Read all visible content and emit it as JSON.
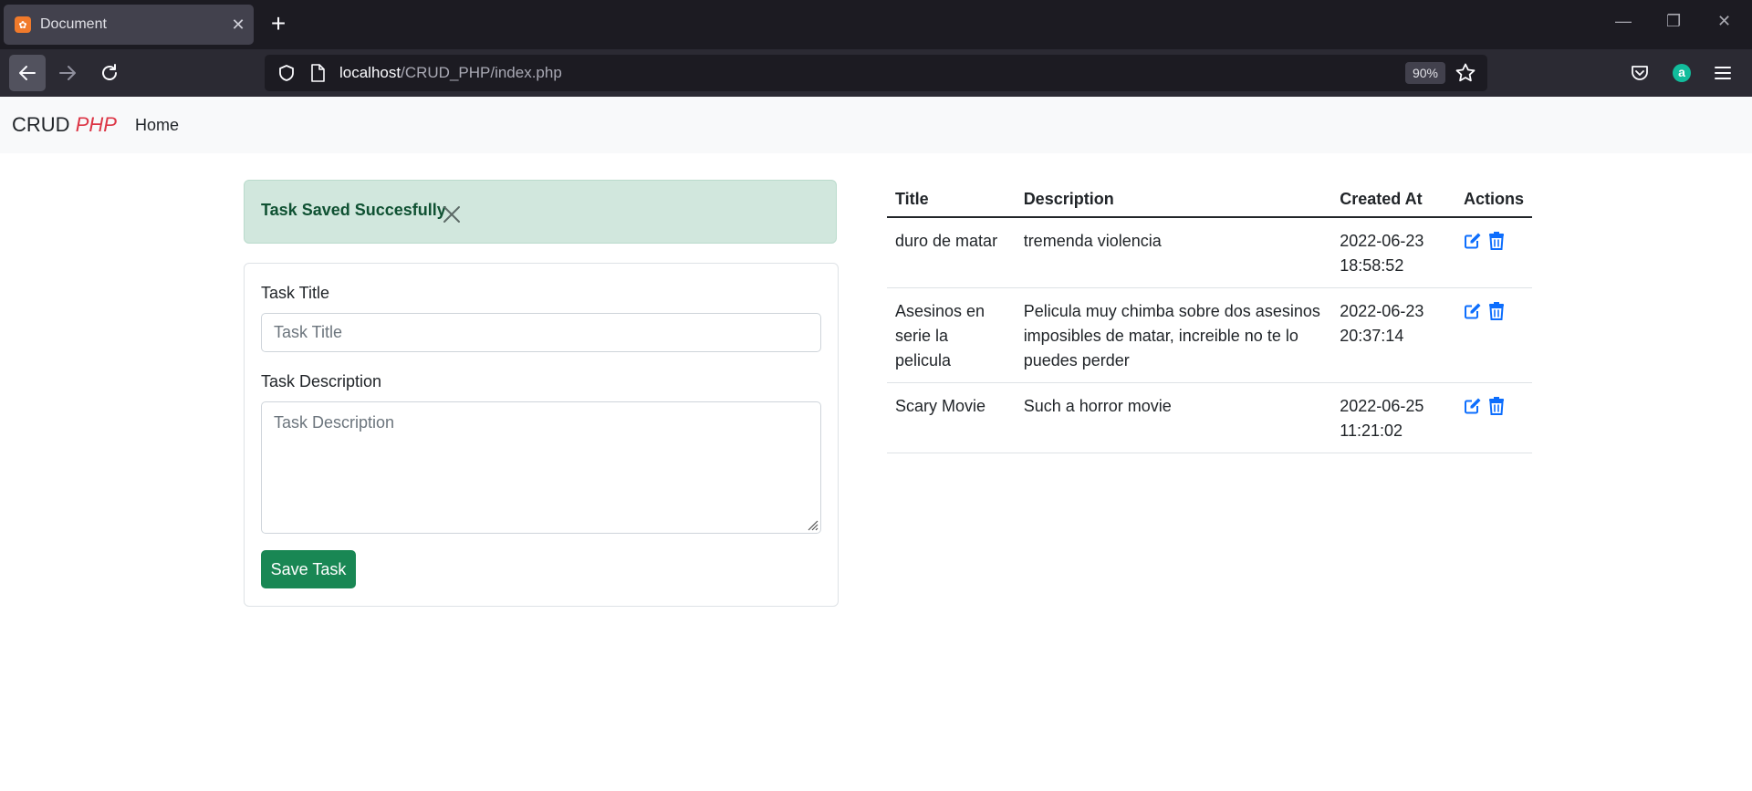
{
  "browser": {
    "tab": {
      "title": "Document",
      "favicon": "xampp-icon"
    },
    "url": {
      "host": "localhost",
      "path": "/CRUD_PHP/index.php"
    },
    "zoom": "90%"
  },
  "navbar": {
    "brand": "CRUD",
    "brand_accent": "PHP",
    "home": "Home"
  },
  "alert": {
    "message": "Task Saved Succesfully"
  },
  "form": {
    "title_label": "Task Title",
    "title_placeholder": "Task Title",
    "title_value": "",
    "description_label": "Task Description",
    "description_placeholder": "Task Description",
    "description_value": "",
    "save_label": "Save Task"
  },
  "table": {
    "headers": {
      "title": "Title",
      "description": "Description",
      "created_at": "Created At",
      "actions": "Actions"
    },
    "rows": [
      {
        "title": "duro de matar",
        "description": "tremenda violencia",
        "date": "2022-06-23",
        "time": "18:58:52"
      },
      {
        "title": "Asesinos en serie la pelicula",
        "description": "Pelicula muy chimba sobre dos asesinos imposibles de matar, increible no te lo puedes perder",
        "date": "2022-06-23",
        "time": "20:37:14"
      },
      {
        "title": "Scary Movie",
        "description": "Such a horror movie",
        "date": "2022-06-25",
        "time": "11:21:02"
      }
    ]
  },
  "colors": {
    "success_button": "#198754",
    "alert_bg": "#d1e7dd",
    "alert_text": "#0f5132",
    "brand_accent": "#dc3545",
    "action_icons": "#0d6efd"
  }
}
